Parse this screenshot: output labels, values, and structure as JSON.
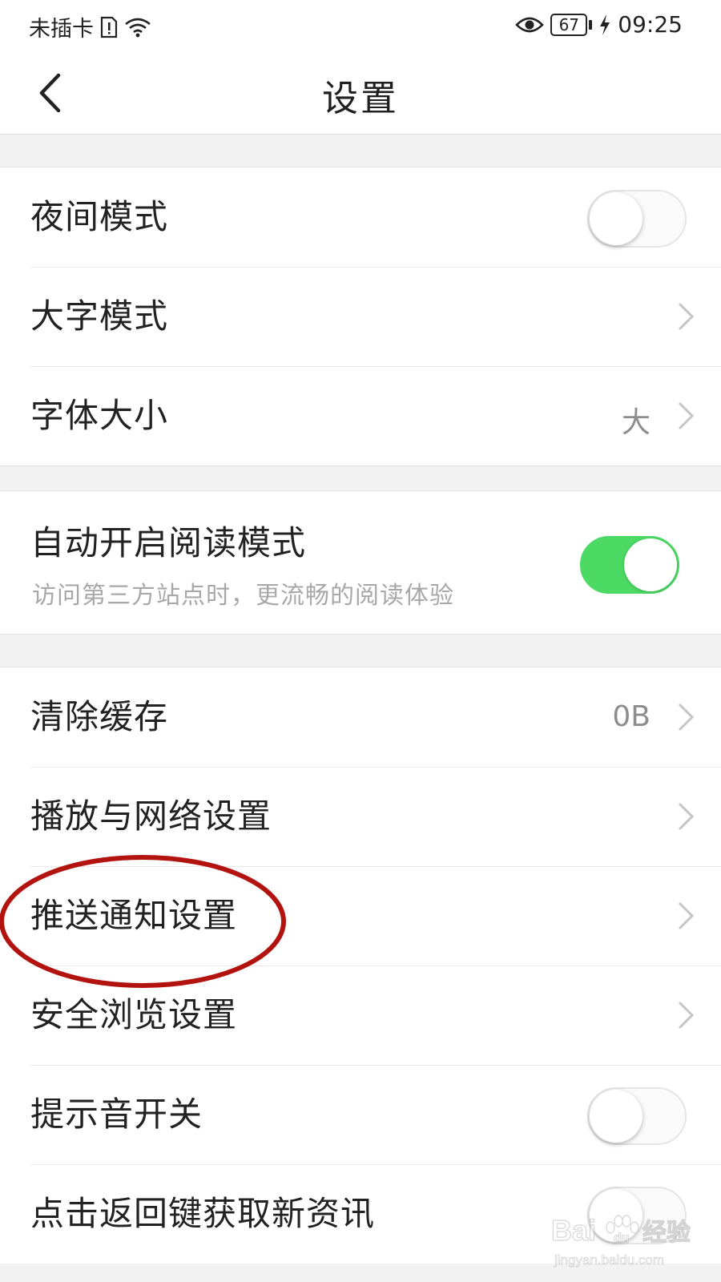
{
  "status_bar": {
    "carrier": "未插卡",
    "battery": "67",
    "time": "09:25"
  },
  "header": {
    "title": "设置"
  },
  "groups": [
    {
      "items": [
        {
          "label": "夜间模式",
          "control": "toggle",
          "on": false
        },
        {
          "label": "大字模式",
          "control": "chevron"
        },
        {
          "label": "字体大小",
          "value": "大",
          "control": "chevron"
        }
      ]
    },
    {
      "items": [
        {
          "label": "自动开启阅读模式",
          "sublabel": "访问第三方站点时，更流畅的阅读体验",
          "control": "toggle",
          "on": true
        }
      ]
    },
    {
      "items": [
        {
          "label": "清除缓存",
          "value": "0B",
          "control": "chevron"
        },
        {
          "label": "播放与网络设置",
          "control": "chevron"
        },
        {
          "label": "推送通知设置",
          "control": "chevron"
        },
        {
          "label": "安全浏览设置",
          "control": "chevron"
        },
        {
          "label": "提示音开关",
          "control": "toggle",
          "on": false
        },
        {
          "label": "点击返回键获取新资讯",
          "control": "toggle",
          "on": false
        }
      ]
    }
  ],
  "colors": {
    "toggle_on": "#4cd964",
    "annotation": "#b3130f"
  },
  "watermark": {
    "logo": "Bai du 经验",
    "url": "jingyan.baidu.com"
  }
}
